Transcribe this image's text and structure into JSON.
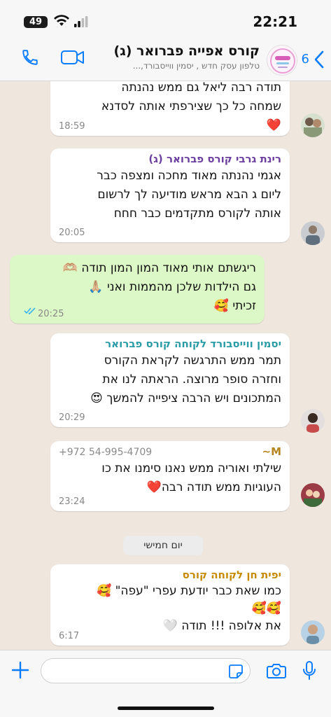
{
  "status_bar": {
    "battery": "49",
    "time": "22:21"
  },
  "header": {
    "title": "קורס אפייה פברואר (ג)",
    "subtitle": "טלפון עסק חדש , יסמין ווייסבורד,...",
    "back_count": "6"
  },
  "colors": {
    "accent": "#0a7cff",
    "outgoing_bubble": "#dcf8c6",
    "incoming_bubble": "#ffffff",
    "chat_background": "#efe7de"
  },
  "messages": [
    {
      "sender": "",
      "text": "תודה רבה ליאל גם ממש נהנתה\nשמחה כל כך שצירפתי אותה לסדנא\n❤️",
      "time": "18:59"
    },
    {
      "sender": "רינת גרבי קורס פברואר (ג)",
      "sender_color": "#6b3fa0",
      "text": "אגמי נהנתה מאוד מחכה ומצפה כבר\nליום ג הבא מראש מודיעה לך לרשום\nאותה לקורס מתקדמים כבר חחח",
      "time": "20:05"
    },
    {
      "sender": "",
      "text": "ריגשתם אותי מאוד המון המון תודה 🫶🏼\nגם הילדות שלכן מהממות ואני 🙏🏼\nזכיתי 🥰",
      "time": "20:25",
      "outgoing": true
    },
    {
      "sender": "יסמין ווייסבורד לקוחה קורס פברואר",
      "sender_color": "#2a9ca6",
      "text": "תמר ממש התרגשה לקראת הקורס\nוחזרה סופר מרוצה. הראתה לנו את\nהמתכונים ויש הרבה ציפייה להמשך 😍",
      "time": "20:29"
    },
    {
      "sender": "M~",
      "sender_color": "#b5841e",
      "phone": "+972 54-995-4709",
      "text": "שילתי ואוריה ממש נאנו סימנו את כו\nהעוגיות ממש תודה רבה❤️",
      "time": "23:24"
    },
    {
      "sender": "יפית חן לקוחה קורס",
      "sender_color": "#c68a00",
      "text": "כמו שאת כבר יודעת עפרי \"עפה\" 🥰\n🥰🥰\nאת אלופה !!! תודה 🤍",
      "time": "6:17"
    }
  ],
  "date_separator": "יום חמישי",
  "input": {
    "placeholder": ""
  },
  "icons": [
    "call-icon",
    "video-icon",
    "back-icon",
    "plus-icon",
    "sticker-icon",
    "camera-icon",
    "mic-icon",
    "wifi-icon",
    "signal-icon",
    "double-check-icon"
  ]
}
